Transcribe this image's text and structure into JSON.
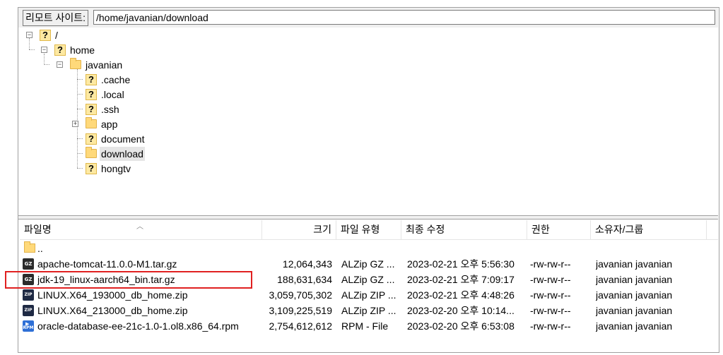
{
  "path_bar": {
    "label": "리모트 사이트:",
    "path": "/home/javanian/download"
  },
  "tree": {
    "root": "/",
    "home": "home",
    "javanian": "javanian",
    "children": [
      ".cache",
      ".local",
      ".ssh",
      "app",
      "document",
      "download",
      "hongtv"
    ],
    "selected": "download"
  },
  "columns": {
    "name": "파일명",
    "size": "크기",
    "type": "파일 유형",
    "modified": "최종 수정",
    "perms": "권한",
    "owner": "소유자/그룹"
  },
  "files": [
    {
      "name": "..",
      "size": "",
      "type": "",
      "modified": "",
      "perms": "",
      "owner": ""
    },
    {
      "name": "apache-tomcat-11.0.0-M1.tar.gz",
      "size": "12,064,343",
      "type": "ALZip GZ ...",
      "modified": "2023-02-21 오후 5:56:30",
      "perms": "-rw-rw-r--",
      "owner": "javanian javanian"
    },
    {
      "name": "jdk-19_linux-aarch64_bin.tar.gz",
      "size": "188,631,634",
      "type": "ALZip GZ ...",
      "modified": "2023-02-21 오후 7:09:17",
      "perms": "-rw-rw-r--",
      "owner": "javanian javanian"
    },
    {
      "name": "LINUX.X64_193000_db_home.zip",
      "size": "3,059,705,302",
      "type": "ALZip ZIP ...",
      "modified": "2023-02-21 오후 4:48:26",
      "perms": "-rw-rw-r--",
      "owner": "javanian javanian"
    },
    {
      "name": "LINUX.X64_213000_db_home.zip",
      "size": "3,109,225,519",
      "type": "ALZip ZIP ...",
      "modified": "2023-02-20 오후 10:14...",
      "perms": "-rw-rw-r--",
      "owner": "javanian javanian"
    },
    {
      "name": "oracle-database-ee-21c-1.0-1.ol8.x86_64.rpm",
      "size": "2,754,612,612",
      "type": "RPM - File",
      "modified": "2023-02-20 오후 6:53:08",
      "perms": "-rw-rw-r--",
      "owner": "javanian javanian"
    }
  ],
  "icons": {
    "gz_label": "GZ",
    "zip_label": "ZIP",
    "rpm_label": "RPM"
  },
  "colors": {
    "highlight": "#e02020",
    "folder": "#ffd97a"
  }
}
